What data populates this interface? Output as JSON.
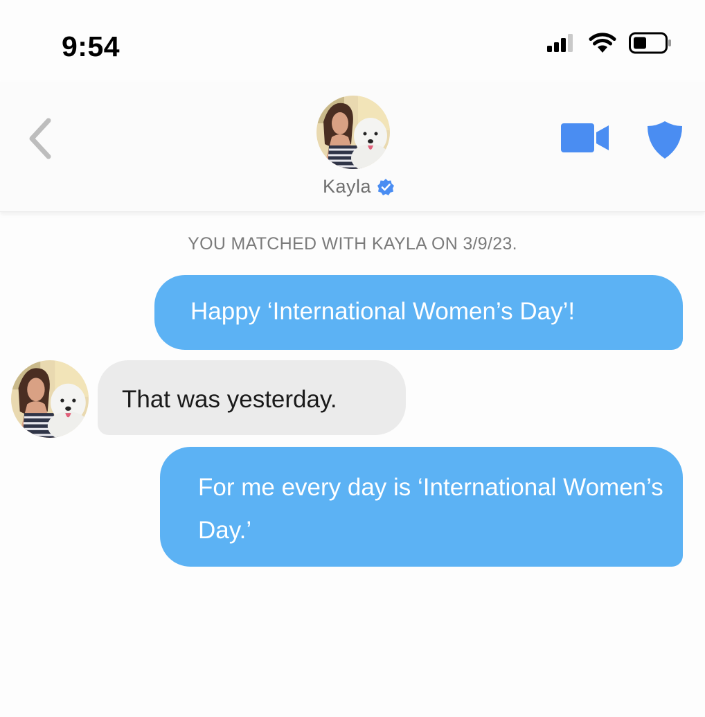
{
  "status_bar": {
    "time": "9:54"
  },
  "header": {
    "contact_name": "Kayla",
    "verified": true,
    "icons": {
      "back": "chevron-left-icon",
      "video": "video-camera-icon",
      "safety": "shield-icon",
      "verified": "verified-badge-icon"
    }
  },
  "match_banner": "YOU MATCHED WITH KAYLA ON 3/9/23.",
  "messages": [
    {
      "sender": "me",
      "text": "Happy ‘International Women’s Day’!"
    },
    {
      "sender": "Kayla",
      "text": "That was yesterday."
    },
    {
      "sender": "me",
      "text": "For me every day is ‘International Women’s Day.’"
    }
  ],
  "colors": {
    "outgoing_bubble": "#5cb2f4",
    "incoming_bubble": "#ebebeb",
    "accent_blue": "#4a8df2",
    "back_chevron": "#bdbdbd"
  }
}
